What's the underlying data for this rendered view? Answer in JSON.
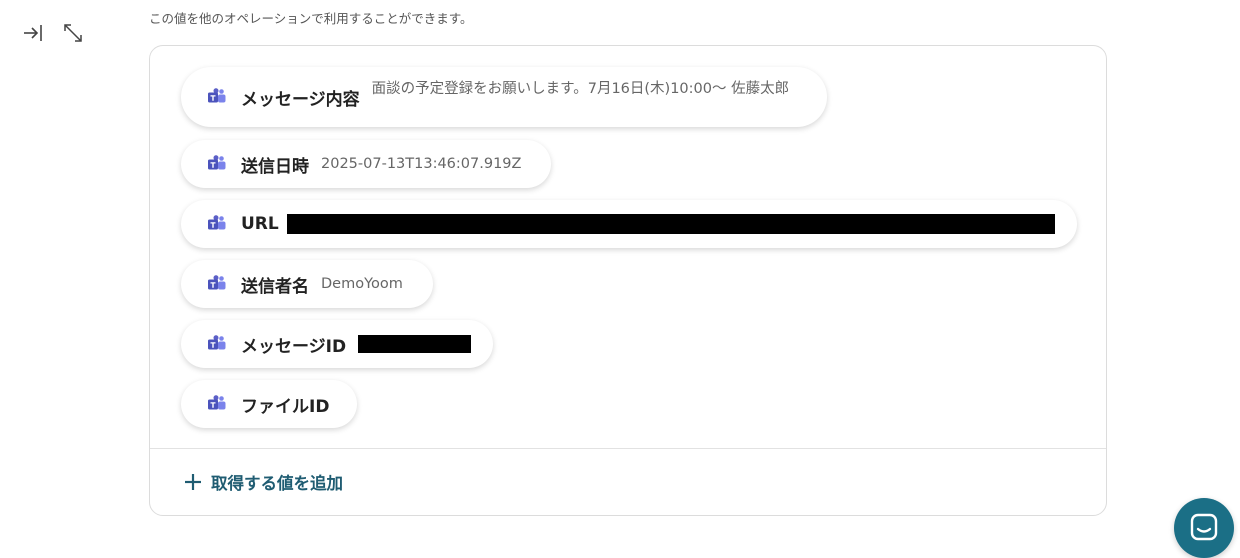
{
  "helper_text": "この値を他のオペレーションで利用することができます。",
  "toolbar": {
    "collapse_icon": "collapse-to-right-icon",
    "expand_icon": "expand-diagonal-icon"
  },
  "fields": [
    {
      "label": "メッセージ内容",
      "value": "面談の予定登録をお願いします。7月16日(木)10:00〜 佐藤太郎",
      "redacted": false
    },
    {
      "label": "送信日時",
      "value": "2025-07-13T13:46:07.919Z",
      "redacted": false
    },
    {
      "label": "URL",
      "value": "",
      "redacted": true
    },
    {
      "label": "送信者名",
      "value": "DemoYoom",
      "redacted": false
    },
    {
      "label": "メッセージID",
      "value": "",
      "redacted": true
    },
    {
      "label": "ファイルID",
      "value": "",
      "redacted": false
    }
  ],
  "add_button": {
    "label": "取得する値を追加"
  },
  "colors": {
    "accent": "#1f5c72",
    "teams_purple": "#5b5fc7",
    "support_bubble": "#1b6f86"
  },
  "icons": {
    "field_icon": "microsoft-teams-icon",
    "support_icon": "chat-support-icon"
  }
}
